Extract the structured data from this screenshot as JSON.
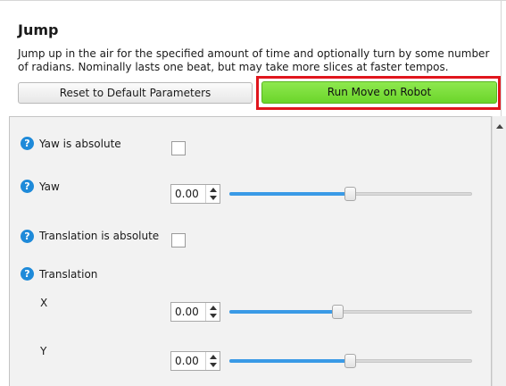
{
  "header": {
    "title": "Jump",
    "description": "Jump up in the air for the specified amount of time and optionally turn by some number of radians. Nominally lasts one beat, but may take more slices at faster tempos."
  },
  "buttons": {
    "reset_label": "Reset to Default Parameters",
    "run_label": "Run Move on Robot"
  },
  "params": {
    "yaw_absolute": {
      "label": "Yaw is absolute",
      "checked": false
    },
    "yaw": {
      "label": "Yaw",
      "value": "0.00",
      "slider_level": 0.5
    },
    "translation_absolute": {
      "label": "Translation is absolute",
      "checked": false
    },
    "translation": {
      "label": "Translation",
      "x": {
        "label": "X",
        "value": "0.00",
        "slider_level": 0.45
      },
      "y": {
        "label": "Y",
        "value": "0.00",
        "slider_level": 0.5
      }
    }
  },
  "colors": {
    "run_button": "#6bd52a",
    "highlight": "#e0161d",
    "help_icon": "#1e8ad9",
    "slider_fill": "#3a9ae6"
  },
  "icons": {
    "help": "?",
    "spin_up": "triangle-up",
    "spin_down": "triangle-down",
    "scroll_up": "triangle-up"
  }
}
